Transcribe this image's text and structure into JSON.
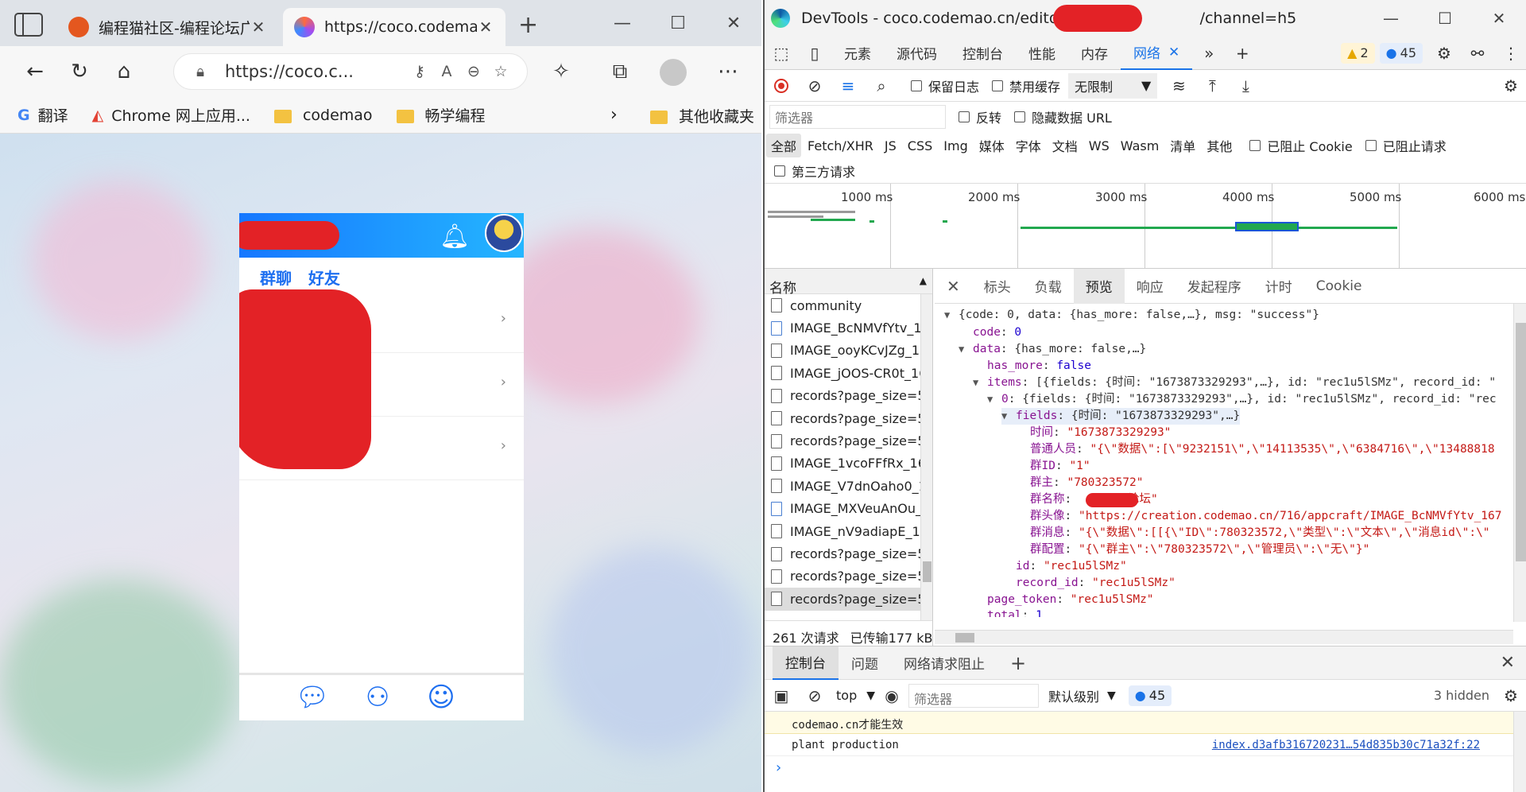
{
  "browser": {
    "tabs": [
      {
        "title": "编程猫社区-编程论坛广",
        "close": "✕"
      },
      {
        "title": "https://coco.codemao.c",
        "close": "✕"
      }
    ],
    "new_tab": "+",
    "address": "https://coco.c...",
    "bookmarks": [
      "翻译",
      "Chrome 网上应用...",
      "codemao",
      "畅学编程"
    ],
    "bookmarks_more": "›",
    "other_bookmarks": "其他收藏夹"
  },
  "app": {
    "tabs": [
      "群聊",
      "好友"
    ],
    "accent": "#1e6ff0"
  },
  "devtools": {
    "title_prefix": "DevTools - coco.codemao.cn/editor/playe",
    "title_suffix": "/channel=h5",
    "panels": [
      "元素",
      "源代码",
      "控制台",
      "性能",
      "内存",
      "网络"
    ],
    "active_panel": "网络",
    "warnings": "2",
    "messages": "45",
    "toolbar": {
      "preserve_log": "保留日志",
      "disable_cache": "禁用缓存",
      "throttle": "无限制"
    },
    "filter": {
      "placeholder": "筛选器",
      "invert": "反转",
      "hide_data_urls": "隐藏数据 URL",
      "types": [
        "全部",
        "Fetch/XHR",
        "JS",
        "CSS",
        "Img",
        "媒体",
        "字体",
        "文档",
        "WS",
        "Wasm",
        "清单",
        "其他"
      ],
      "blocked_cookies": "已阻止 Cookie",
      "blocked_requests": "已阻止请求",
      "third_party": "第三方请求"
    },
    "timeline_ticks": [
      "1000 ms",
      "2000 ms",
      "3000 ms",
      "4000 ms",
      "5000 ms",
      "6000 ms"
    ],
    "requests": {
      "header": "名称",
      "items": [
        "community",
        "IMAGE_BcNMVfYtv_16",
        "IMAGE_ooyKCvJZg_16",
        "IMAGE_jOOS-CR0t_16",
        "records?page_size=50",
        "records?page_size=50",
        "records?page_size=50",
        "IMAGE_1vcoFFfRx_167",
        "IMAGE_V7dnOaho0_1",
        "IMAGE_MXVeuAnOu_",
        "IMAGE_nV9adiapE_16",
        "records?page_size=50",
        "records?page_size=50",
        "records?page_size=50"
      ],
      "footer_count": "261 次请求",
      "footer_size": "已传输177 kB"
    },
    "detail_tabs": [
      "标头",
      "负载",
      "预览",
      "响应",
      "发起程序",
      "计时",
      "Cookie"
    ],
    "active_detail": "预览",
    "preview": {
      "l1": "{code: 0, data: {has_more: false,…}, msg: \"success\"}",
      "code_key": "code",
      "code_val": "0",
      "data_key": "data",
      "data_val": "{has_more: false,…}",
      "has_more_key": "has_more",
      "has_more_val": "false",
      "items_key": "items",
      "items_val": "[{fields: {时间: \"1673873329293\",…}, id: \"rec1u5lSMz\", record_id: \"",
      "item0_key": "0",
      "item0_val": "{fields: {时间: \"1673873329293\",…}, id: \"rec1u5lSMz\", record_id: \"rec",
      "fields_key": "fields",
      "fields_val": "{时间: \"1673873329293\",…}",
      "f_time_key": "时间",
      "f_time_val": "\"1673873329293\"",
      "f_members_key": "普通人员",
      "f_members_val": "\"{\\\"数据\\\":[\\\"9232151\\\",\\\"14113535\\\",\\\"6384716\\\",\\\"13488818",
      "f_gid_key": "群ID",
      "f_gid_val": "\"1\"",
      "f_owner_key": "群主",
      "f_owner_val": "\"780323572\"",
      "f_name_key": "群名称",
      "f_name_val": "论坛\"",
      "f_avatar_key": "群头像",
      "f_avatar_val": "\"https://creation.codemao.cn/716/appcraft/IMAGE_BcNMVfYtv_167",
      "f_msg_key": "群消息",
      "f_msg_val": "\"{\\\"数据\\\":[[{\\\"ID\\\":780323572,\\\"类型\\\":\\\"文本\\\",\\\"消息id\\\":\\\"",
      "f_cfg_key": "群配置",
      "f_cfg_val": "\"{\\\"群主\\\":\\\"780323572\\\",\\\"管理员\\\":\\\"无\\\"}\"",
      "id_key": "id",
      "id_val": "\"rec1u5lSMz\"",
      "rid_key": "record_id",
      "rid_val": "\"rec1u5lSMz\"",
      "pt_key": "page_token",
      "pt_val": "\"rec1u5lSMz\"",
      "total_key": "total",
      "total_val": "1"
    },
    "drawer": {
      "tabs": [
        "控制台",
        "问题",
        "网络请求阻止"
      ],
      "context": "top",
      "filter_placeholder": "筛选器",
      "level": "默认级别",
      "count": "45",
      "hidden": "3 hidden",
      "msg1": "codemao.cn才能生效",
      "msg2": "plant production",
      "msg2_source": "index.d3afb316720231…54d835b30c71a32f:22"
    }
  }
}
